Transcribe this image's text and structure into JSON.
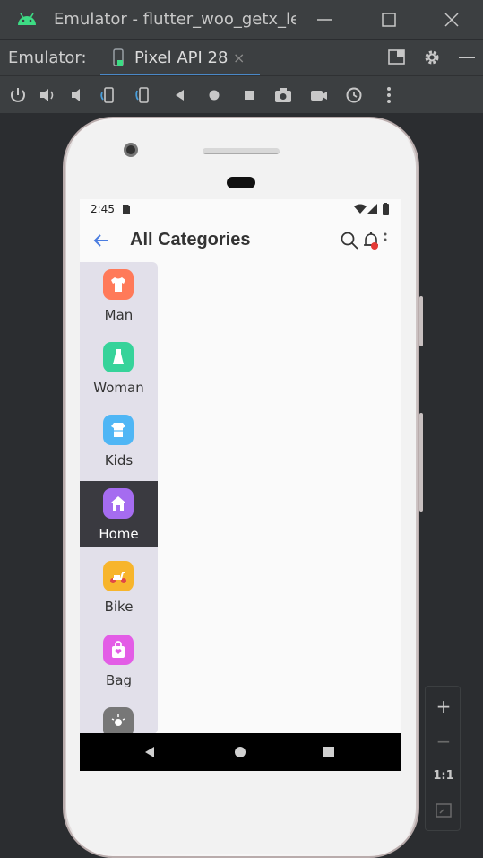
{
  "window": {
    "title": "Emulator - flutter_woo_getx_le",
    "minimize_icon": "minimize-icon",
    "maximize_icon": "maximize-icon",
    "close_icon": "close-icon"
  },
  "tabbar": {
    "label": "Emulator:",
    "tab_name": "Pixel API 28",
    "tab_close": "×"
  },
  "statusbar": {
    "time": "2:45"
  },
  "app": {
    "title": "All Categories",
    "categories": [
      {
        "label": "Man",
        "icon": "shirt-icon",
        "color": "#ff7a59"
      },
      {
        "label": "Woman",
        "icon": "dress-icon",
        "color": "#36d39a"
      },
      {
        "label": "Kids",
        "icon": "kids-dress-icon",
        "color": "#4fb6f5"
      },
      {
        "label": "Home",
        "icon": "home-icon",
        "color": "#a56cf0"
      },
      {
        "label": "Bike",
        "icon": "scooter-icon",
        "color": "#f7b52c"
      },
      {
        "label": "Bag",
        "icon": "bag-icon",
        "color": "#e35de6"
      },
      {
        "label": "",
        "icon": "lamp-icon",
        "color": "#777777"
      }
    ],
    "active_category": "Home"
  },
  "zoom": {
    "plus": "+",
    "minus": "−",
    "one_to_one": "1:1"
  },
  "colors": {
    "accent": "#4a88c7",
    "android_green": "#3ddc84"
  }
}
